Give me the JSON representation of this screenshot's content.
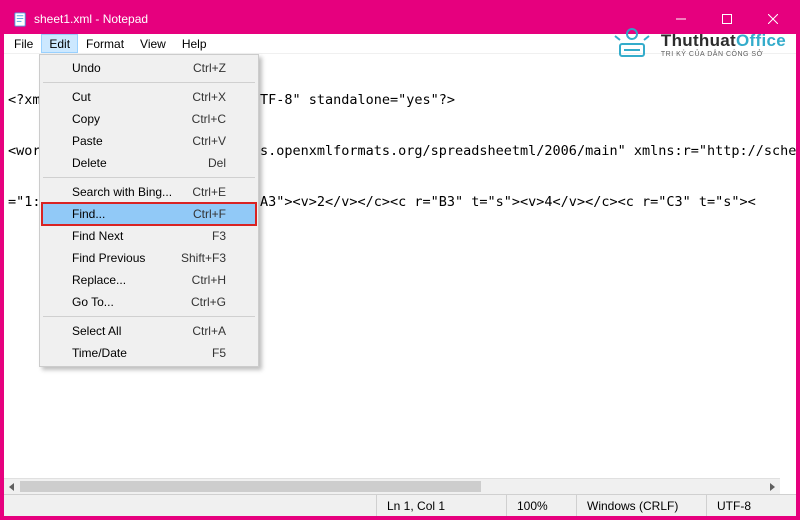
{
  "window": {
    "title": "sheet1.xml - Notepad"
  },
  "menubar": [
    "File",
    "Edit",
    "Format",
    "View",
    "Help"
  ],
  "open_menu_index": 1,
  "edit_menu": {
    "groups": [
      [
        {
          "label": "Undo",
          "accel": "Ctrl+Z"
        }
      ],
      [
        {
          "label": "Cut",
          "accel": "Ctrl+X"
        },
        {
          "label": "Copy",
          "accel": "Ctrl+C"
        },
        {
          "label": "Paste",
          "accel": "Ctrl+V"
        },
        {
          "label": "Delete",
          "accel": "Del"
        }
      ],
      [
        {
          "label": "Search with Bing...",
          "accel": "Ctrl+E"
        },
        {
          "label": "Find...",
          "accel": "Ctrl+F",
          "highlight": true
        },
        {
          "label": "Find Next",
          "accel": "F3"
        },
        {
          "label": "Find Previous",
          "accel": "Shift+F3"
        },
        {
          "label": "Replace...",
          "accel": "Ctrl+H"
        },
        {
          "label": "Go To...",
          "accel": "Ctrl+G"
        }
      ],
      [
        {
          "label": "Select All",
          "accel": "Ctrl+A"
        },
        {
          "label": "Time/Date",
          "accel": "F5"
        }
      ]
    ]
  },
  "document_lines": [
    "<?xml version=\"1.0\" encoding=\"UTF-8\" standalone=\"yes\"?>",
    "<worksheet xmlns=\"http://schemas.openxmlformats.org/spreadsheetml/2006/main\" xmlns:r=\"http://sche",
    "=\"1:1048576\"/><row r=\"3\"><c r=\"A3\"><v>2</v></c><c r=\"B3\" t=\"s\"><v>4</v></c><c r=\"C3\" t=\"s\"><"
  ],
  "statusbar": {
    "position": "Ln 1, Col 1",
    "zoom": "100%",
    "line_ending": "Windows (CRLF)",
    "encoding": "UTF-8"
  },
  "watermark": {
    "brand_prefix": "Thuthuat",
    "brand_suffix": "Office",
    "tagline": "TRI KỶ CỦA DÂN CÔNG SỞ"
  },
  "colors": {
    "accent": "#e6007e",
    "menu_highlight": "#91c9f7",
    "callout_border": "#d92323"
  }
}
